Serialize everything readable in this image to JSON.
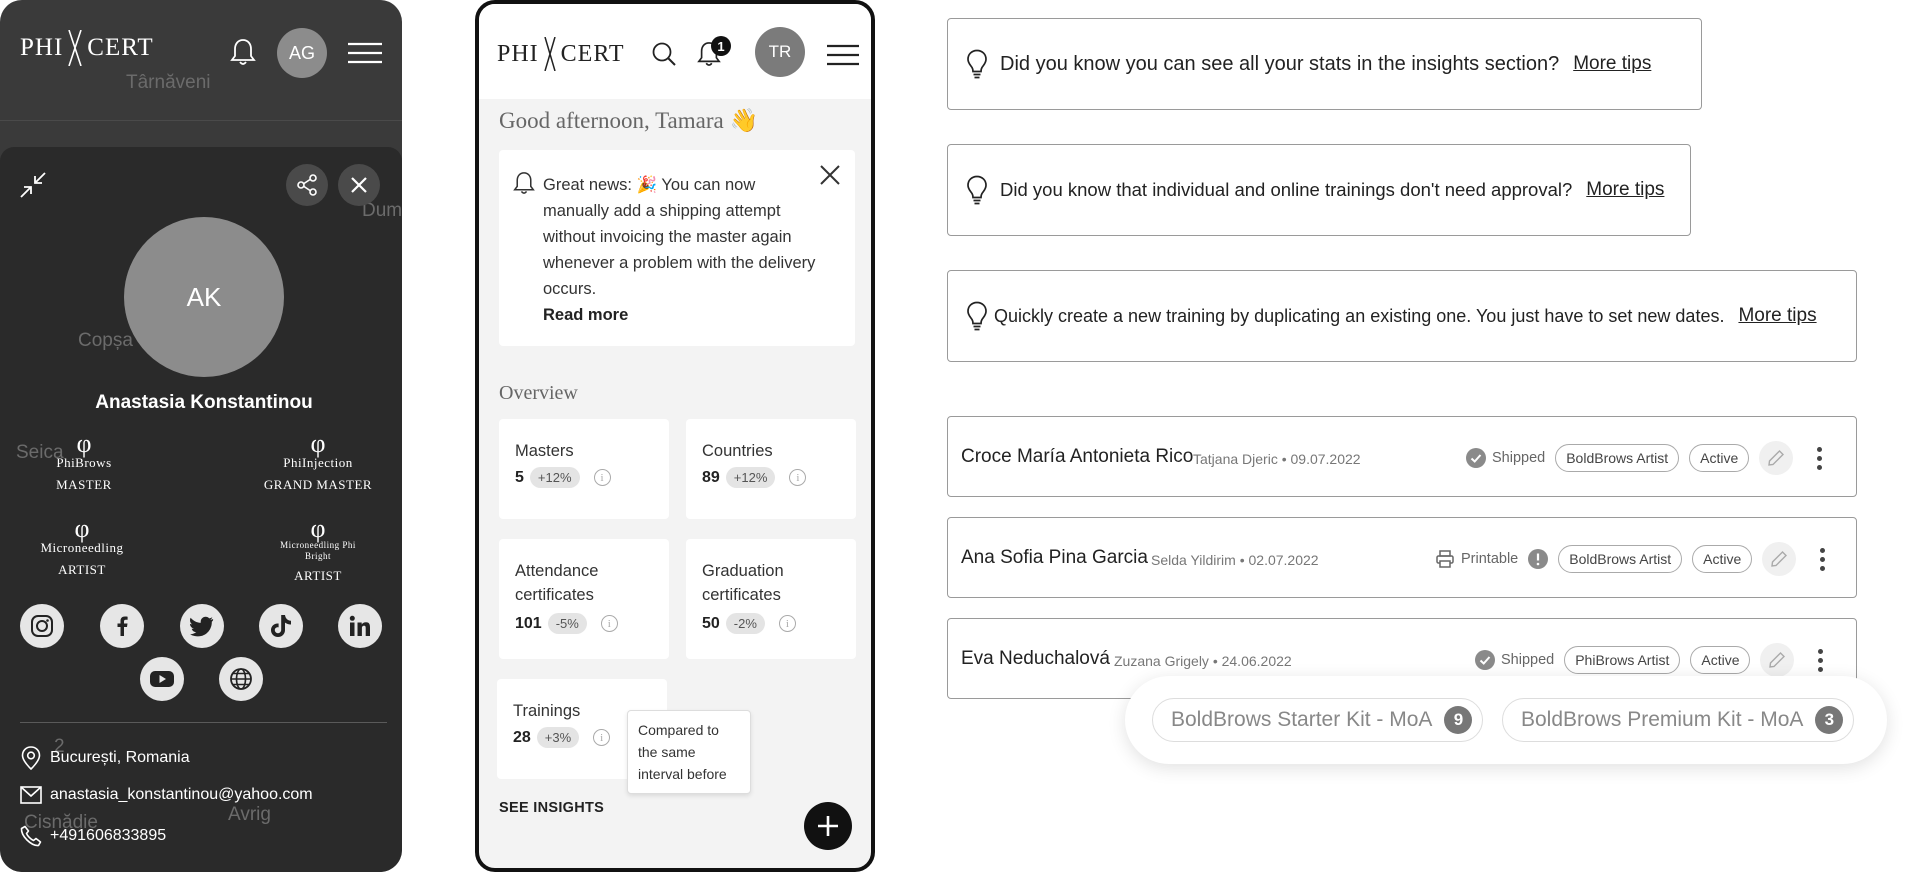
{
  "brand": {
    "logo_left": "PHI",
    "logo_right": "CERT"
  },
  "left_panel": {
    "map_labels": [
      "Târnăveni",
      "Dum",
      "Copșa",
      "Seica",
      "Cisnădie",
      "Avrig",
      "2"
    ],
    "user_avatar": "AG",
    "profile": {
      "initials": "AK",
      "name": "Anastasia Konstantinou",
      "badges": [
        {
          "line1": "PhiBrows",
          "line2": "MASTER"
        },
        {
          "line1": "PhiInjection",
          "line2": "GRAND MASTER"
        },
        {
          "line1": "Microneedling",
          "line2": "ARTIST"
        },
        {
          "line1": "Microneedling Phi Bright",
          "line2": "ARTIST"
        }
      ],
      "socials": [
        "instagram-icon",
        "facebook-icon",
        "twitter-icon",
        "tiktok-icon",
        "linkedin-icon",
        "youtube-icon",
        "globe-icon"
      ],
      "location": "București, Romania",
      "email": "anastasia_konstantinou@yahoo.com",
      "phone": "+491606833895"
    }
  },
  "phone": {
    "notification_count": "1",
    "user_avatar": "TR",
    "greeting": "Good afternoon, Tamara 👋",
    "notice": {
      "text": "Great news: 🎉 You can now manually add a shipping attempt without invoicing the master again whenever a problem with the delivery occurs.",
      "read_more": "Read more"
    },
    "overview_title": "Overview",
    "stats": [
      {
        "label": "Masters",
        "value": "5",
        "delta": "+12%"
      },
      {
        "label": "Countries",
        "value": "89",
        "delta": "+12%"
      },
      {
        "label": "Attendance certificates",
        "value": "101",
        "delta": "-5%"
      },
      {
        "label": "Graduation certificates",
        "value": "50",
        "delta": "-2%"
      },
      {
        "label": "Trainings",
        "value": "28",
        "delta": "+3%"
      }
    ],
    "tooltip": "Compared to the same interval before",
    "see_insights": "SEE INSIGHTS"
  },
  "tips": [
    {
      "text": "Did you know you can see all your stats in the insights section?",
      "link": "More tips"
    },
    {
      "text": "Did you know that individual and online trainings don't need approval?",
      "link": "More tips"
    },
    {
      "text": "Quickly create a new training by duplicating an existing one. You just have to set new dates.",
      "link": "More tips"
    }
  ],
  "orders": [
    {
      "name": "Croce María Antonieta Rico",
      "sub": "Tatjana Djeric  •  09.07.2022",
      "status": "Shipped",
      "product": "BoldBrows Artist",
      "state": "Active"
    },
    {
      "name": "Ana Sofia Pina Garcia",
      "sub": "Selda Yildirim  •  02.07.2022",
      "status": "Printable",
      "product": "BoldBrows Artist",
      "state": "Active"
    },
    {
      "name": "Eva Neduchalová",
      "sub": "Zuzana Grigely   •  24.06.2022",
      "status": "Shipped",
      "product": "PhiBrows Artist",
      "state": "Active"
    }
  ],
  "kits": [
    {
      "label": "BoldBrows Starter Kit - MoA",
      "count": "9"
    },
    {
      "label": "BoldBrows Premium Kit - MoA",
      "count": "3"
    }
  ]
}
